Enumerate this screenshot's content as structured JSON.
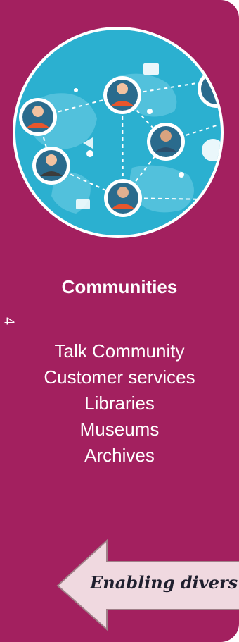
{
  "card": {
    "title": "Communities",
    "side_number": "4",
    "links": [
      "Talk Community",
      "Customer services",
      "Libraries",
      "Museums",
      "Archives"
    ],
    "arrow_text": "Enabling divers"
  },
  "colors": {
    "panel": "#a3205f",
    "globe": "#2bb0d0",
    "arrow_fill": "#f0d9e0",
    "arrow_stroke": "#a07f88"
  },
  "icons": [
    "network-globe-illustration",
    "left-arrow"
  ]
}
